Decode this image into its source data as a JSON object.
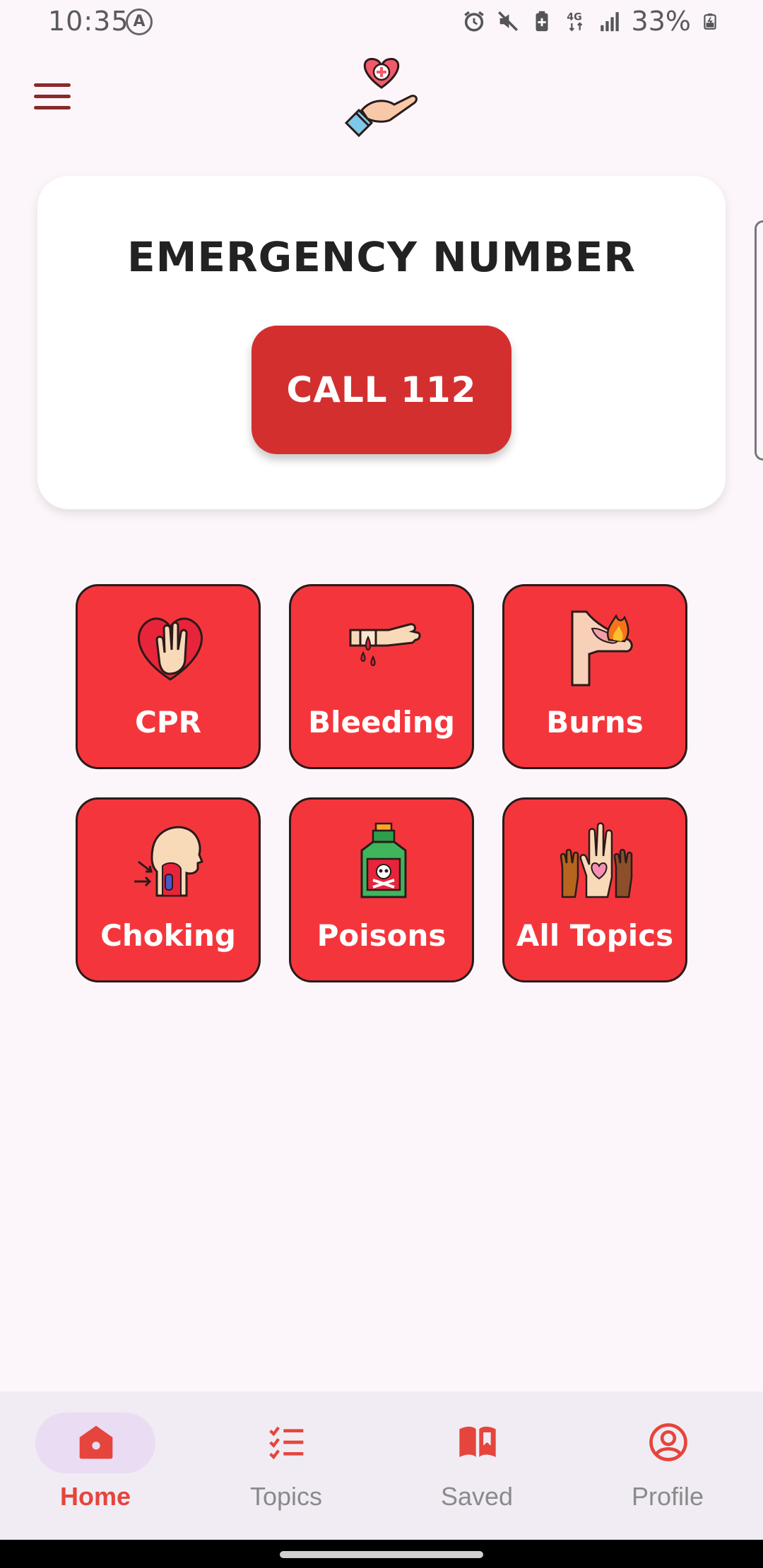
{
  "status_bar": {
    "time": "10:35",
    "battery": "33%",
    "icons": [
      "accessibility-icon",
      "alarm-icon",
      "mute-icon",
      "battery-saver-icon",
      "4g-icon",
      "signal-icon",
      "battery-icon"
    ],
    "network": "4G"
  },
  "header": {
    "menu_icon": "hamburger-menu-icon",
    "logo_icon": "heart-hand-logo-icon"
  },
  "emergency": {
    "title": "EMERGENCY NUMBER",
    "call_label": "CALL 112"
  },
  "topics": [
    {
      "label": "CPR",
      "icon": "heart-hand-icon"
    },
    {
      "label": "Bleeding",
      "icon": "bleeding-hand-icon"
    },
    {
      "label": "Burns",
      "icon": "burn-arm-icon"
    },
    {
      "label": "Choking",
      "icon": "choking-throat-icon"
    },
    {
      "label": "Poisons",
      "icon": "poison-bottle-icon"
    },
    {
      "label": "All Topics",
      "icon": "raised-hands-icon"
    }
  ],
  "nav": {
    "items": [
      {
        "label": "Home",
        "icon": "home-icon",
        "active": true
      },
      {
        "label": "Topics",
        "icon": "checklist-icon",
        "active": false
      },
      {
        "label": "Saved",
        "icon": "bookmark-book-icon",
        "active": false
      },
      {
        "label": "Profile",
        "icon": "profile-icon",
        "active": false
      }
    ]
  },
  "colors": {
    "tile_red": "#f4363c",
    "call_red": "#d32f2f",
    "nav_active": "#e5453c",
    "background": "#fcf6fb"
  }
}
